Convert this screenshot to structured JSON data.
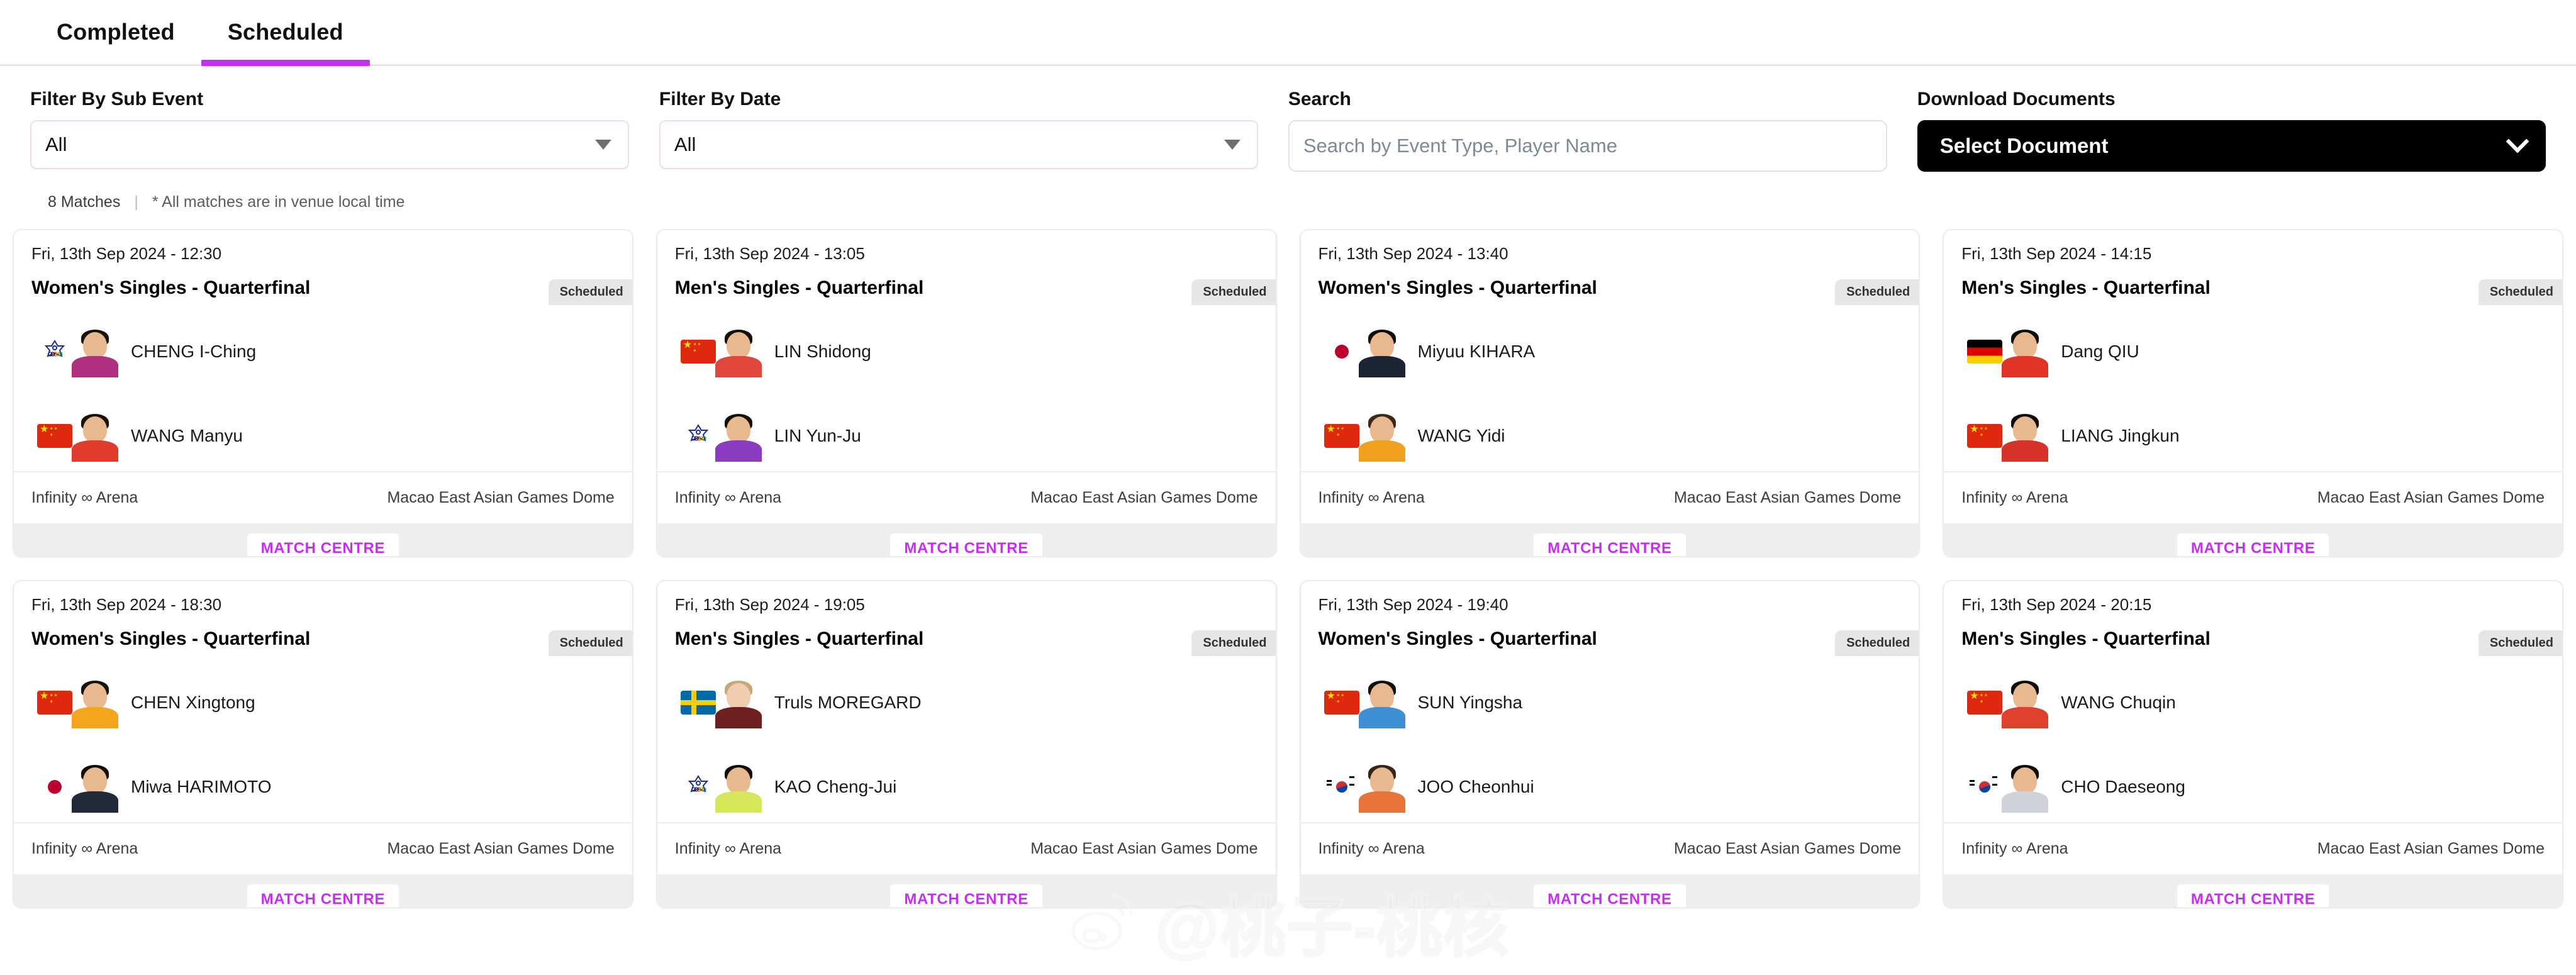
{
  "tabs": [
    {
      "label": "Completed",
      "active": false
    },
    {
      "label": "Scheduled",
      "active": true
    }
  ],
  "filters": {
    "sub_event": {
      "label": "Filter By Sub Event",
      "value": "All",
      "icon": "chevron-down-icon"
    },
    "date": {
      "label": "Filter By Date",
      "value": "All",
      "icon": "chevron-down-icon"
    },
    "search": {
      "label": "Search",
      "value": "",
      "placeholder": "Search by Event Type, Player Name"
    },
    "download": {
      "label": "Download Documents",
      "value": "Select Document",
      "icon": "chevron-down-icon"
    }
  },
  "meta": {
    "count": "8 Matches",
    "separator": "|",
    "note": "* All matches are in venue local time"
  },
  "labels": {
    "match_centre": "MATCH CENTRE",
    "status": "Scheduled"
  },
  "venue": {
    "arena": "Infinity ∞ Arena",
    "dome": "Macao East Asian Games Dome"
  },
  "colors": {
    "accent": "#c42ff0",
    "badge_bg": "#e6e6e6",
    "card_border": "#ececec",
    "footer_bg": "#eeeeee",
    "download_bg": "#000000"
  },
  "watermark": {
    "handle": "@桃子-桃核",
    "logo": "weibo-logo-icon"
  },
  "matches": [
    {
      "datetime": "Fri, 13th Sep 2024 - 12:30",
      "title": "Women's Singles - Quarterfinal",
      "status": "Scheduled",
      "arena": "Infinity ∞ Arena",
      "dome": "Macao East Asian Games Dome",
      "players": [
        {
          "name": "CHENG I-Ching",
          "flag": "tpe",
          "kit": "#b0307f",
          "hair": "#1b1108"
        },
        {
          "name": "WANG Manyu",
          "flag": "cn",
          "kit": "#e23b2e",
          "hair": "#1b1108"
        }
      ]
    },
    {
      "datetime": "Fri, 13th Sep 2024 - 13:05",
      "title": "Men's Singles - Quarterfinal",
      "status": "Scheduled",
      "arena": "Infinity ∞ Arena",
      "dome": "Macao East Asian Games Dome",
      "players": [
        {
          "name": "LIN Shidong",
          "flag": "cn",
          "kit": "#e0463c",
          "hair": "#16100a"
        },
        {
          "name": "LIN Yun-Ju",
          "flag": "tpe",
          "kit": "#8a3bbf",
          "hair": "#16100a"
        }
      ]
    },
    {
      "datetime": "Fri, 13th Sep 2024 - 13:40",
      "title": "Women's Singles - Quarterfinal",
      "status": "Scheduled",
      "arena": "Infinity ∞ Arena",
      "dome": "Macao East Asian Games Dome",
      "players": [
        {
          "name": "Miyuu KIHARA",
          "flag": "jp",
          "kit": "#1d2433",
          "hair": "#140d07"
        },
        {
          "name": "WANG Yidi",
          "flag": "cn",
          "kit": "#f0a21e",
          "hair": "#3c2a16"
        }
      ]
    },
    {
      "datetime": "Fri, 13th Sep 2024 - 14:15",
      "title": "Men's Singles - Quarterfinal",
      "status": "Scheduled",
      "arena": "Infinity ∞ Arena",
      "dome": "Macao East Asian Games Dome",
      "players": [
        {
          "name": "Dang QIU",
          "flag": "de",
          "kit": "#e03225",
          "hair": "#120c07"
        },
        {
          "name": "LIANG Jingkun",
          "flag": "cn",
          "kit": "#d8332a",
          "hair": "#120c07"
        }
      ]
    },
    {
      "datetime": "Fri, 13th Sep 2024 - 18:30",
      "title": "Women's Singles - Quarterfinal",
      "status": "Scheduled",
      "arena": "Infinity ∞ Arena",
      "dome": "Macao East Asian Games Dome",
      "players": [
        {
          "name": "CHEN Xingtong",
          "flag": "cn",
          "kit": "#f3a51c",
          "hair": "#1a1109"
        },
        {
          "name": "Miwa HARIMOTO",
          "flag": "jp",
          "kit": "#222a3a",
          "hair": "#140d07"
        }
      ]
    },
    {
      "datetime": "Fri, 13th Sep 2024 - 19:05",
      "title": "Men's Singles - Quarterfinal",
      "status": "Scheduled",
      "arena": "Infinity ∞ Arena",
      "dome": "Macao East Asian Games Dome",
      "players": [
        {
          "name": "Truls MOREGARD",
          "flag": "se",
          "kit": "#6e2020",
          "hair": "#c9a878",
          "skin": "#f0cdb0"
        },
        {
          "name": "KAO Cheng-Jui",
          "flag": "tpe",
          "kit": "#d6e85a",
          "hair": "#140d07"
        }
      ]
    },
    {
      "datetime": "Fri, 13th Sep 2024 - 19:40",
      "title": "Women's Singles - Quarterfinal",
      "status": "Scheduled",
      "arena": "Infinity ∞ Arena",
      "dome": "Macao East Asian Games Dome",
      "players": [
        {
          "name": "SUN Yingsha",
          "flag": "cn",
          "kit": "#3f8fd4",
          "hair": "#140d07"
        },
        {
          "name": "JOO Cheonhui",
          "flag": "kr",
          "kit": "#e8743a",
          "hair": "#3a2414"
        }
      ]
    },
    {
      "datetime": "Fri, 13th Sep 2024 - 20:15",
      "title": "Men's Singles - Quarterfinal",
      "status": "Scheduled",
      "arena": "Infinity ∞ Arena",
      "dome": "Macao East Asian Games Dome",
      "players": [
        {
          "name": "WANG Chuqin",
          "flag": "cn",
          "kit": "#e0402f",
          "hair": "#110b06"
        },
        {
          "name": "CHO Daeseong",
          "flag": "kr",
          "kit": "#cfd2d8",
          "hair": "#110b06"
        }
      ]
    }
  ]
}
